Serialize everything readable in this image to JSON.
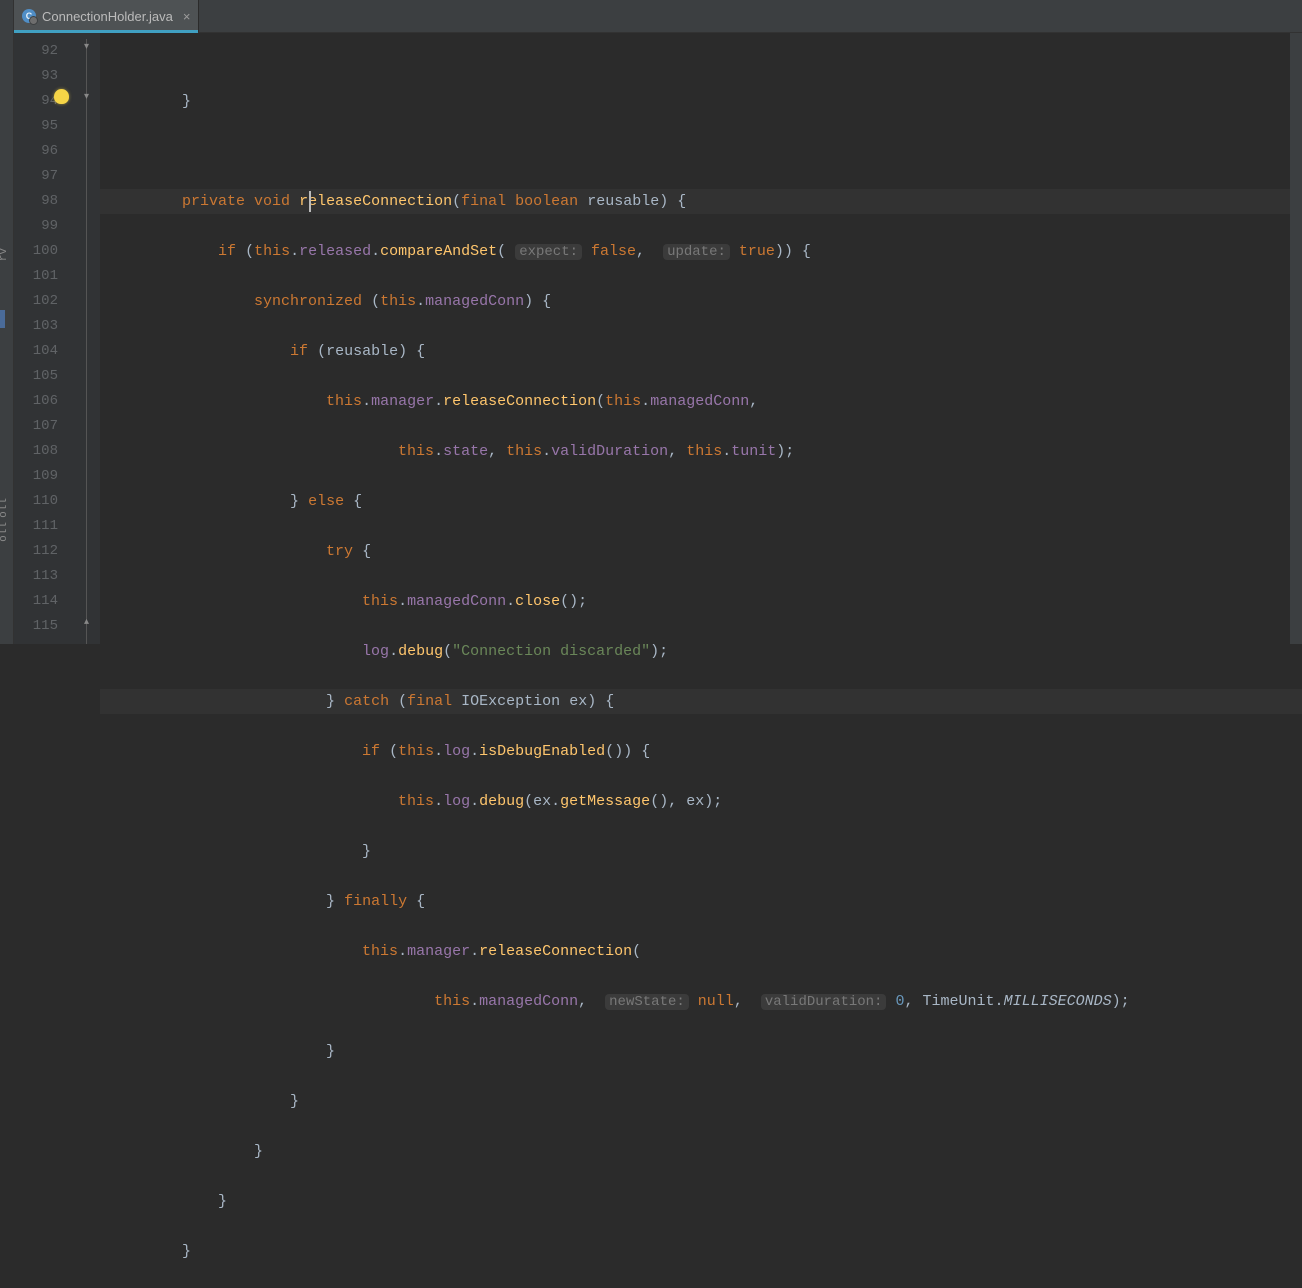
{
  "tab": {
    "filename": "ConnectionHolder.java",
    "icon_letter": "C"
  },
  "sidebar_text_1": "rv",
  "sidebar_text_2": "oll",
  "sidebar_text_3": "oll",
  "line_start": 92,
  "line_end": 115,
  "hints": {
    "expect": "expect:",
    "update": "update:",
    "newState": "newState:",
    "validDuration": "validDuration:"
  },
  "tokens": {
    "private": "private",
    "void": "void",
    "final": "final",
    "boolean": "boolean",
    "if": "if",
    "else": "else",
    "try": "try",
    "catch": "catch",
    "finally": "finally",
    "synchronized": "synchronized",
    "this": "this",
    "false": "false",
    "true": "true",
    "null": "null",
    "zero": "0",
    "releaseConnection": "releaseConnection",
    "reusable": "reusable",
    "released": "released",
    "compareAndSet": "compareAndSet",
    "managedConn": "managedConn",
    "manager": "manager",
    "state": "state",
    "validDuration": "validDuration",
    "tunit": "tunit",
    "close": "close",
    "log": "log",
    "debug": "debug",
    "conn_discarded": "\"Connection discarded\"",
    "IOException": "IOException",
    "ex": "ex",
    "isDebugEnabled": "isDebugEnabled",
    "getMessage": "getMessage",
    "TimeUnit": "TimeUnit",
    "MILLISECONDS": "MILLISECONDS"
  }
}
